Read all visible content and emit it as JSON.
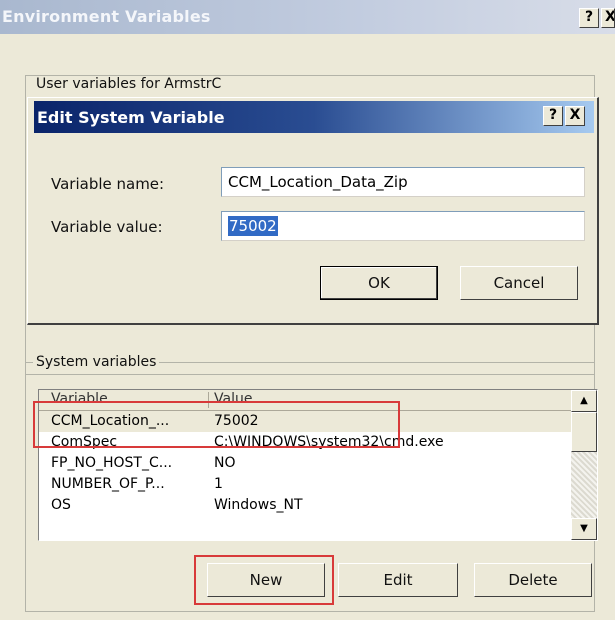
{
  "outer_window": {
    "title": "Environment Variables",
    "help_label": "?",
    "close_label": "X"
  },
  "user_group": {
    "label": "User variables for ArmstrC"
  },
  "dialog": {
    "title": "Edit System Variable",
    "help_label": "?",
    "close_label": "X",
    "name_label": "Variable name:",
    "name_value": "CCM_Location_Data_Zip",
    "value_label": "Variable value:",
    "value_value": "75002",
    "ok_label": "OK",
    "cancel_label": "Cancel"
  },
  "system_group": {
    "label": "System variables",
    "columns": [
      "Variable",
      "Value"
    ],
    "rows": [
      {
        "variable": "CCM_Location_...",
        "value": "75002"
      },
      {
        "variable": "ComSpec",
        "value": "C:\\WINDOWS\\system32\\cmd.exe"
      },
      {
        "variable": "FP_NO_HOST_C...",
        "value": "NO"
      },
      {
        "variable": "NUMBER_OF_P...",
        "value": "1"
      },
      {
        "variable": "OS",
        "value": "Windows_NT"
      }
    ],
    "new_label": "New",
    "edit_label": "Edit",
    "delete_label": "Delete"
  },
  "colors": {
    "dialog_title_start": "#0a246a",
    "dialog_title_end": "#a6caf0",
    "highlight": "#d83a3a",
    "selection": "#316ac5"
  }
}
